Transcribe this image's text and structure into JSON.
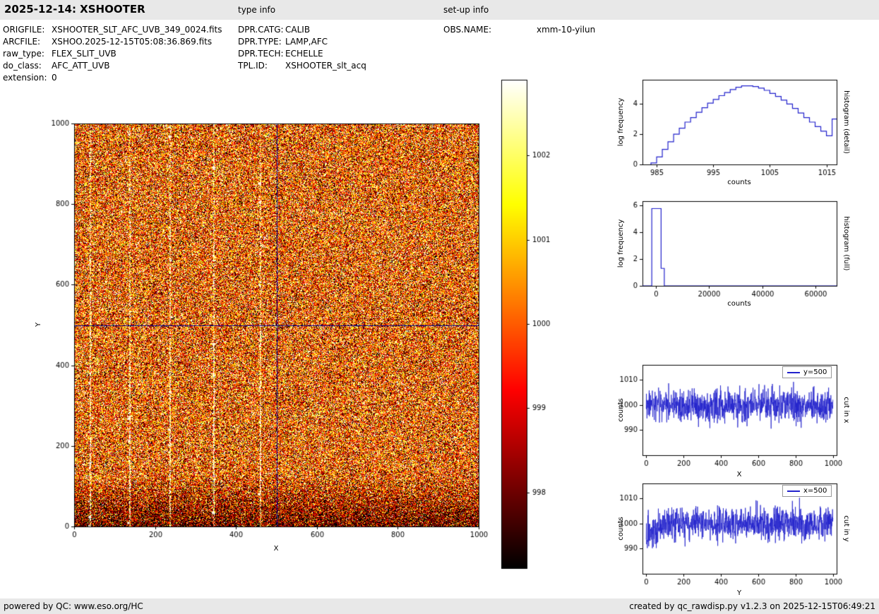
{
  "header": {
    "title": "2025-12-14: XSHOOTER",
    "type_info_label": "type info",
    "setup_info_label": "set-up info"
  },
  "metadata": {
    "left": [
      {
        "key": "ORIGFILE:",
        "value": "XSHOOTER_SLT_AFC_UVB_349_0024.fits"
      },
      {
        "key": "ARCFILE:",
        "value": "XSHOO.2025-12-15T05:08:36.869.fits"
      },
      {
        "key": "raw_type:",
        "value": "FLEX_SLIT_UVB"
      },
      {
        "key": "do_class:",
        "value": "AFC_ATT_UVB"
      },
      {
        "key": "extension:",
        "value": "0"
      }
    ],
    "middle": [
      {
        "key": "DPR.CATG:",
        "value": "CALIB"
      },
      {
        "key": "DPR.TYPE:",
        "value": "LAMP,AFC"
      },
      {
        "key": "DPR.TECH:",
        "value": "ECHELLE"
      },
      {
        "key": "TPL.ID:",
        "value": "XSHOOTER_slt_acq"
      }
    ],
    "right": [
      {
        "key": "OBS.NAME:",
        "value": "xmm-10-yilun"
      }
    ]
  },
  "footer": {
    "left": "powered by QC: www.eso.org/HC",
    "right": "created by qc_rawdisp.py v1.2.3 on 2025-12-15T06:49:21"
  },
  "chart_data": [
    {
      "id": "main_image",
      "type": "heatmap",
      "xlabel": "X",
      "ylabel": "Y",
      "xlim": [
        0,
        1000
      ],
      "ylim": [
        0,
        1000
      ],
      "xticks": [
        0,
        200,
        400,
        600,
        800,
        1000
      ],
      "yticks": [
        0,
        200,
        400,
        600,
        800,
        1000
      ],
      "colormap": "hot",
      "vmin": 997.1,
      "vmax": 1002.9,
      "mean": 1000,
      "noise_sigma": 2.0,
      "dark_bottom_rows": 130,
      "bright_columns": [
        38,
        136,
        236,
        344,
        459
      ],
      "crosshair": {
        "x": 500,
        "y": 500,
        "color": "#00008b"
      }
    },
    {
      "id": "colorbar",
      "type": "colorbar",
      "colormap": "hot",
      "vmin": 997.1,
      "vmax": 1002.9,
      "ticks": [
        998,
        999,
        1000,
        1001,
        1002
      ]
    },
    {
      "id": "histogram_detail",
      "type": "line",
      "plot_style": "step-histogram",
      "xlabel": "counts",
      "ylabel": "log frequency",
      "right_label": "histogram (detail)",
      "xlim": [
        982.5,
        1016.8
      ],
      "ylim": [
        0,
        5.6
      ],
      "xticks": [
        985,
        995,
        1005,
        1015
      ],
      "yticks": [
        0,
        2,
        4
      ],
      "line_color": "#2222cc",
      "bin_start": 984,
      "bin_width": 1,
      "bin_values": [
        0.1,
        0.5,
        1.0,
        1.5,
        2.0,
        2.4,
        2.8,
        3.1,
        3.45,
        3.75,
        4.05,
        4.3,
        4.55,
        4.75,
        4.95,
        5.1,
        5.2,
        5.2,
        5.15,
        5.05,
        4.9,
        4.7,
        4.5,
        4.25,
        4.0,
        3.7,
        3.4,
        3.1,
        2.8,
        2.5,
        2.2,
        1.9,
        3.0
      ]
    },
    {
      "id": "histogram_full",
      "type": "line",
      "plot_style": "step-histogram",
      "xlabel": "counts",
      "ylabel": "log frequency",
      "right_label": "histogram (full)",
      "xlim": [
        -5000,
        68000
      ],
      "ylim": [
        0,
        6.3
      ],
      "xticks": [
        0,
        20000,
        40000,
        60000
      ],
      "yticks": [
        0,
        2,
        4,
        6
      ],
      "line_color": "#2222cc",
      "line_x": [
        -5000,
        -1500,
        -1500,
        2000,
        2000,
        3200,
        3200,
        68000
      ],
      "line_y": [
        0,
        0,
        5.75,
        5.75,
        1.3,
        1.3,
        0,
        0
      ]
    },
    {
      "id": "cut_x",
      "type": "line",
      "xlabel": "X",
      "ylabel": "counts",
      "right_label": "cut in x",
      "legend": "y=500",
      "xlim": [
        -20,
        1020
      ],
      "ylim": [
        980,
        1016
      ],
      "xticks": [
        0,
        200,
        400,
        600,
        800,
        1000
      ],
      "yticks": [
        990,
        1000,
        1010
      ],
      "line_color": "#2222cc",
      "mean": 1000,
      "sigma": 3.3,
      "n_points": 1000
    },
    {
      "id": "cut_y",
      "type": "line",
      "xlabel": "Y",
      "ylabel": "counts",
      "right_label": "cut in y",
      "legend": "x=500",
      "xlim": [
        -20,
        1020
      ],
      "ylim": [
        980,
        1016
      ],
      "xticks": [
        0,
        200,
        400,
        600,
        800,
        1000
      ],
      "yticks": [
        990,
        1000,
        1010
      ],
      "line_color": "#2222cc",
      "mean": 1000,
      "sigma": 3.3,
      "n_points": 1000,
      "left_dip": {
        "width": 120,
        "depth": 5
      }
    }
  ]
}
